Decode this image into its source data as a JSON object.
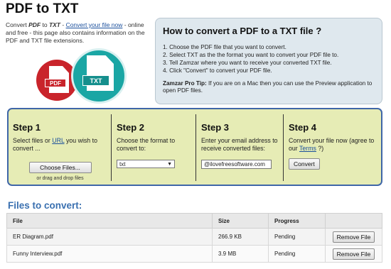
{
  "header": {
    "title": "PDF to TXT"
  },
  "intro": {
    "part1": "Convert ",
    "pdf": "PDF",
    "to": " to ",
    "txt": "TXT",
    "part2": " - ",
    "link": "Convert your file now",
    "part3": " - online and free - this page also contains information on the PDF and TXT file extensions."
  },
  "icons": {
    "pdf_label": "PDF",
    "txt_label": "TXT"
  },
  "howto": {
    "title": "How to convert a PDF to a TXT file ?",
    "steps": [
      "1. Choose the PDF file that you want to convert.",
      "2. Select TXT as the the format you want to convert your PDF file to.",
      "3. Tell Zamzar where you want to receive your converted TXT file.",
      "4. Click \"Convert\" to convert your PDF file."
    ],
    "tip_label": "Zamzar Pro Tip:",
    "tip_text": " If you are on a Mac then you can use the Preview application to open PDF files."
  },
  "steps": {
    "step1": {
      "title": "Step 1",
      "desc_a": "Select files or ",
      "desc_link": "URL",
      "desc_b": " you wish to convert ...",
      "button": "Choose Files...",
      "note": "or drag and drop files"
    },
    "step2": {
      "title": "Step 2",
      "desc": "Choose the format to convert to:",
      "selected": "txt"
    },
    "step3": {
      "title": "Step 3",
      "desc": "Enter your email address to receive converted files:",
      "email": "@ilovefreesoftware.com"
    },
    "step4": {
      "title": "Step 4",
      "desc_a": "Convert your file now (agree to our ",
      "desc_link": "Terms",
      "desc_b": " ?)",
      "button": "Convert"
    }
  },
  "files": {
    "title": "Files to convert:",
    "columns": [
      "File",
      "Size",
      "Progress",
      ""
    ],
    "rows": [
      {
        "file": "ER Diagram.pdf",
        "size": "266.9 KB",
        "progress": "Pending",
        "action": "Remove File"
      },
      {
        "file": "Funny Interview.pdf",
        "size": "3.9 MB",
        "progress": "Pending",
        "action": "Remove File"
      }
    ]
  },
  "colors": {
    "accent": "#3a70b0",
    "panel": "#e6ecb5",
    "pdf_red": "#c9242b",
    "txt_teal": "#1aa6a4"
  }
}
